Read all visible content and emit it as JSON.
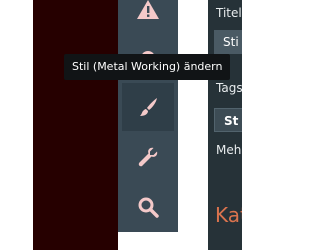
{
  "toolbar": {
    "items": [
      {
        "icon": "warning-icon"
      },
      {
        "icon": "pin-icon"
      },
      {
        "icon": "paintbrush-icon"
      },
      {
        "icon": "wrench-icon"
      },
      {
        "icon": "search-icon"
      }
    ]
  },
  "tooltip": {
    "text": "Stil (Metal Working) ändern"
  },
  "panel": {
    "title_label": "Titel",
    "title_value": "Sti",
    "tags_label": "Tags",
    "tags_value": "St",
    "more_label": "Mehr",
    "section_heading": "Kat"
  },
  "colors": {
    "main_background": "#260000",
    "toolbar": "#3a4a55",
    "panel": "#263238",
    "icon_fill": "#f4c9c9",
    "heading_accent": "#d9734e"
  }
}
